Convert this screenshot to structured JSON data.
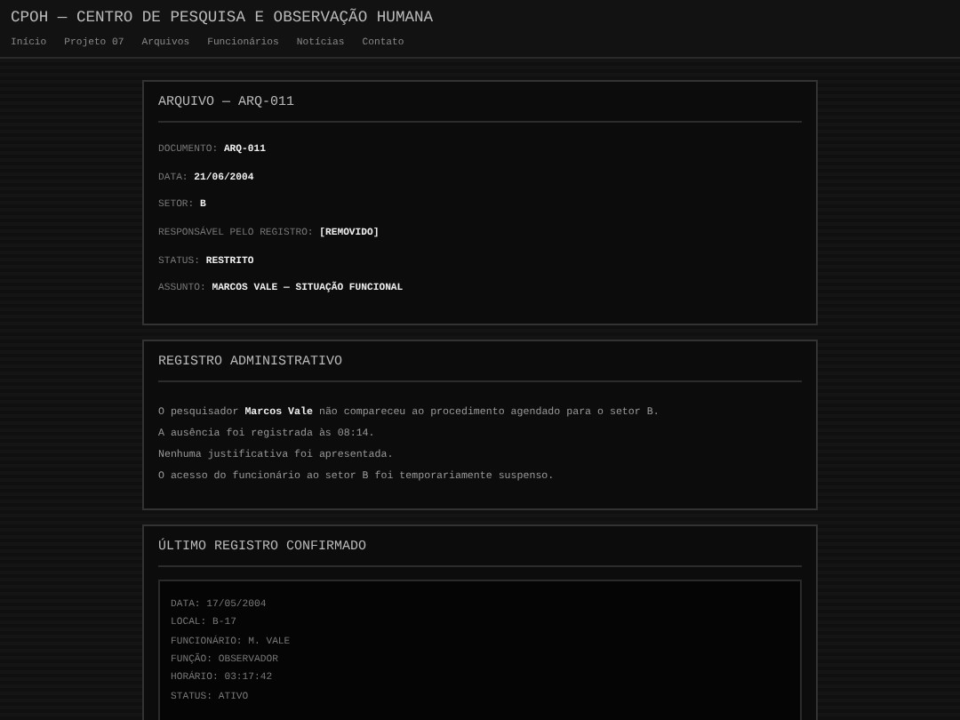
{
  "header": {
    "title": "CPOH — CENTRO DE PESQUISA E OBSERVAÇÃO HUMANA",
    "nav": [
      {
        "label": "Início"
      },
      {
        "label": "Projeto 07"
      },
      {
        "label": "Arquivos"
      },
      {
        "label": "Funcionários"
      },
      {
        "label": "Notícias"
      },
      {
        "label": "Contato"
      }
    ]
  },
  "sections": [
    {
      "kind": "fields",
      "title": "ARQUIVO — ARQ-011",
      "fields": [
        {
          "label": "DOCUMENTO:",
          "value": "ARQ-011"
        },
        {
          "label": "DATA:",
          "value": "21/06/2004"
        },
        {
          "label": "SETOR:",
          "value": "B"
        },
        {
          "label": "RESPONSÁVEL PELO REGISTRO:",
          "value": "[REMOVIDO]"
        },
        {
          "label": "STATUS:",
          "value": "RESTRITO"
        },
        {
          "label": "ASSUNTO:",
          "value": "MARCOS VALE — SITUAÇÃO FUNCIONAL"
        }
      ]
    },
    {
      "kind": "text",
      "title": "REGISTRO ADMINISTRATIVO",
      "lines": [
        "O pesquisador **Marcos Vale** não compareceu ao procedimento agendado para o setor B.",
        "A ausência foi registrada às 08:14.",
        "Nenhuma justificativa foi apresentada.",
        "O acesso do funcionário ao setor B foi temporariamente suspenso."
      ]
    },
    {
      "kind": "log",
      "title": "ÚLTIMO REGISTRO CONFIRMADO",
      "lines": [
        "DATA: 17/05/2004",
        "LOCAL: B-17",
        "FUNCIONÁRIO: M. VALE",
        "FUNÇÃO: OBSERVADOR",
        "HORÁRIO: 03:17:42",
        "STATUS: ATIVO"
      ]
    }
  ]
}
